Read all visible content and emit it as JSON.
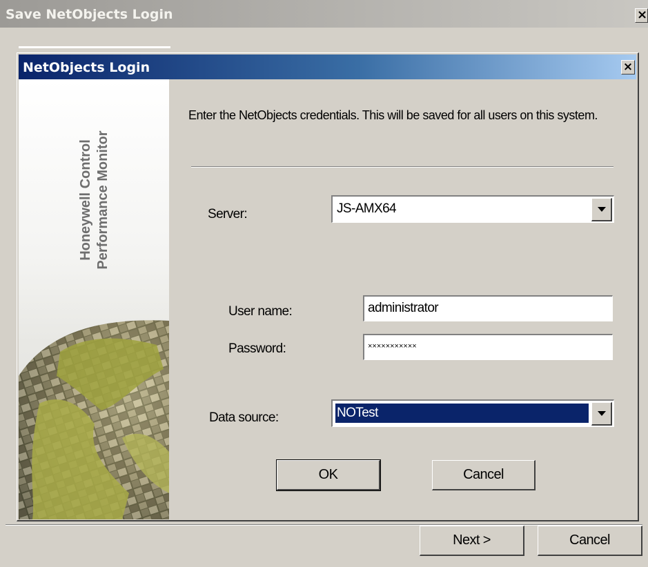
{
  "outer_window": {
    "title": "Save NetObjects Login",
    "close_symbol": "×",
    "buttons": {
      "next": "Next >",
      "cancel": "Cancel"
    }
  },
  "dialog": {
    "title": "NetObjects Login",
    "close_symbol": "×",
    "banner": {
      "line1": "Honeywell Control",
      "line2": "Performance Monitor"
    },
    "intro": "Enter the NetObjects credentials.  This will be saved for all users on this system.",
    "server": {
      "label": "Server:",
      "value": "JS-AMX64"
    },
    "username": {
      "label": "User name:",
      "value": "administrator"
    },
    "password": {
      "label": "Password:",
      "value": "×××××××××××"
    },
    "data_source": {
      "label": "Data source:",
      "value": "NOTest"
    },
    "buttons": {
      "ok": "OK",
      "cancel": "Cancel"
    }
  },
  "colors": {
    "dialog_title_gradient_start": "#0a246a",
    "dialog_title_gradient_end": "#a6caf0",
    "selection": "#0a246a",
    "face": "#d4d0c8"
  }
}
